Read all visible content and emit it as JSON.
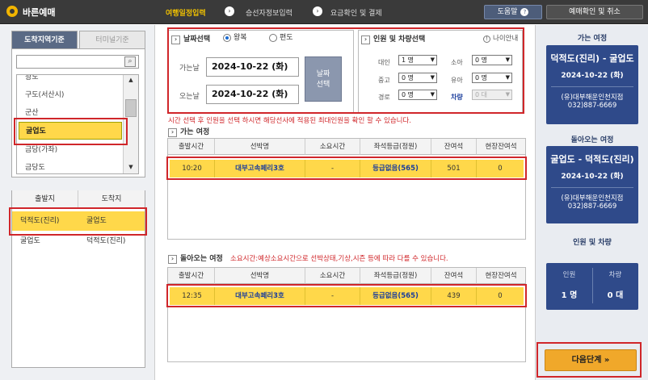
{
  "app": {
    "title": "바른예매"
  },
  "steps": [
    {
      "label": "여행일정입력"
    },
    {
      "label": "승선자정보입력"
    },
    {
      "label": "요금확인 및 결제"
    }
  ],
  "header": {
    "help_label": "도움말",
    "confirm_label": "예매확인 및 취소"
  },
  "left": {
    "tabs": {
      "region": "도착지역기준",
      "terminal": "터미널기준"
    },
    "search": {
      "value": "",
      "placeholder": ""
    },
    "regions": [
      "광도",
      "구도(서산시)",
      "군산",
      "굴업도",
      "금당(가좌)",
      "금당도"
    ],
    "selected_region": "굴업도",
    "route_headers": {
      "departure": "출발지",
      "arrival": "도착지"
    },
    "routes": [
      {
        "departure": "덕적도(진리)",
        "arrival": "굴업도"
      },
      {
        "departure": "굴업도",
        "arrival": "덕적도(진리)"
      }
    ]
  },
  "date_section": {
    "title": "날짜선택",
    "round_trip": "왕복",
    "one_way": "편도",
    "selected": "왕복",
    "go_label": "가는날",
    "go_date": "2024-10-22 (화)",
    "return_label": "오는날",
    "return_date": "2024-10-22 (화)",
    "date_button": "날짜\n선택"
  },
  "pax_section": {
    "title": "인원 및 차량선택",
    "info_label": "나이안내",
    "adult": {
      "label": "대인",
      "value": "1 명"
    },
    "child": {
      "label": "소아",
      "value": "0 명"
    },
    "teen": {
      "label": "중고",
      "value": "0 명"
    },
    "infant": {
      "label": "유아",
      "value": "0 명"
    },
    "senior": {
      "label": "경로",
      "value": "0 명"
    },
    "vehicle": {
      "label": "차량",
      "value": "0 대"
    }
  },
  "notice": "시간 선택 후 인원을 선택 하시면 해당선사에 적용된 최대인원을 확인 할 수 있습니다.",
  "outbound": {
    "title": "가는 여정",
    "columns": [
      "출발시간",
      "선박명",
      "소요시간",
      "좌석등급(정원)",
      "잔여석",
      "현장잔여석"
    ],
    "rows": [
      {
        "time": "10:20",
        "ship": "대부고속페리3호",
        "duration": "-",
        "grade": "등급없음(565)",
        "remaining": "501",
        "onsite": "0"
      }
    ]
  },
  "inbound": {
    "title": "돌아오는 여정",
    "note": "소요시간:예상소요시간으로 선박상태,기상,시즌 등에 따라 다를 수 있습니다.",
    "columns": [
      "출발시간",
      "선박명",
      "소요시간",
      "좌석등급(정원)",
      "잔여석",
      "현장잔여석"
    ],
    "rows": [
      {
        "time": "12:35",
        "ship": "대부고속페리3호",
        "duration": "-",
        "grade": "등급없음(565)",
        "remaining": "439",
        "onsite": "0"
      }
    ]
  },
  "right": {
    "go_title": "가는 여정",
    "go_card": {
      "route": "덕적도(진리) - 굴업도",
      "date": "2024-10-22 (화)",
      "agency": "(유)대부해운인천지점",
      "phone": "032)887-6669"
    },
    "return_title": "돌아오는 여정",
    "return_card": {
      "route": "굴업도 - 덕적도(진리)",
      "date": "2024-10-22 (화)",
      "agency": "(유)대부해운인천지점",
      "phone": "032)887-6669"
    },
    "count_title": "인원 및 차량",
    "count": {
      "people_label": "인원",
      "people": "1 명",
      "vehicle_label": "차량",
      "vehicle": "0 대"
    },
    "next_label": "다음단계"
  },
  "colors": {
    "accent": "#f2c200",
    "navy": "#2f4a8a",
    "highlight": "#ffd84a",
    "red": "#d0262a"
  }
}
